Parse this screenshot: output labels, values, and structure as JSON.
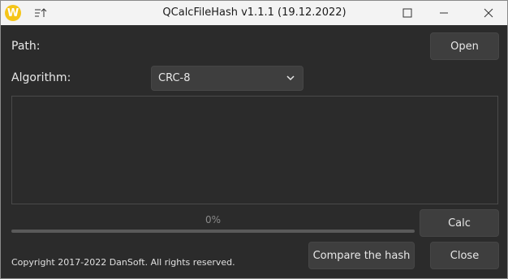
{
  "window": {
    "title": "QCalcFileHash v1.1.1 (19.12.2022)",
    "logo_letter": "W",
    "accent": "#f5c518"
  },
  "form": {
    "path_label": "Path:",
    "open_label": "Open",
    "algorithm_label": "Algorithm:",
    "algorithm_value": "CRC-8",
    "hash_output": ""
  },
  "progress": {
    "text": "0%",
    "value": 0
  },
  "actions": {
    "calc_label": "Calc",
    "compare_label": "Compare the hash",
    "close_label": "Close"
  },
  "footer": {
    "copyright": "Copyright 2017-2022 DanSoft. All rights reserved."
  },
  "icons": {
    "logo": "app-logo-icon",
    "pin": "stay-on-top-icon",
    "maximize": "maximize-icon",
    "minimize": "minimize-icon",
    "close": "close-icon",
    "dropdown": "chevron-down-icon"
  }
}
